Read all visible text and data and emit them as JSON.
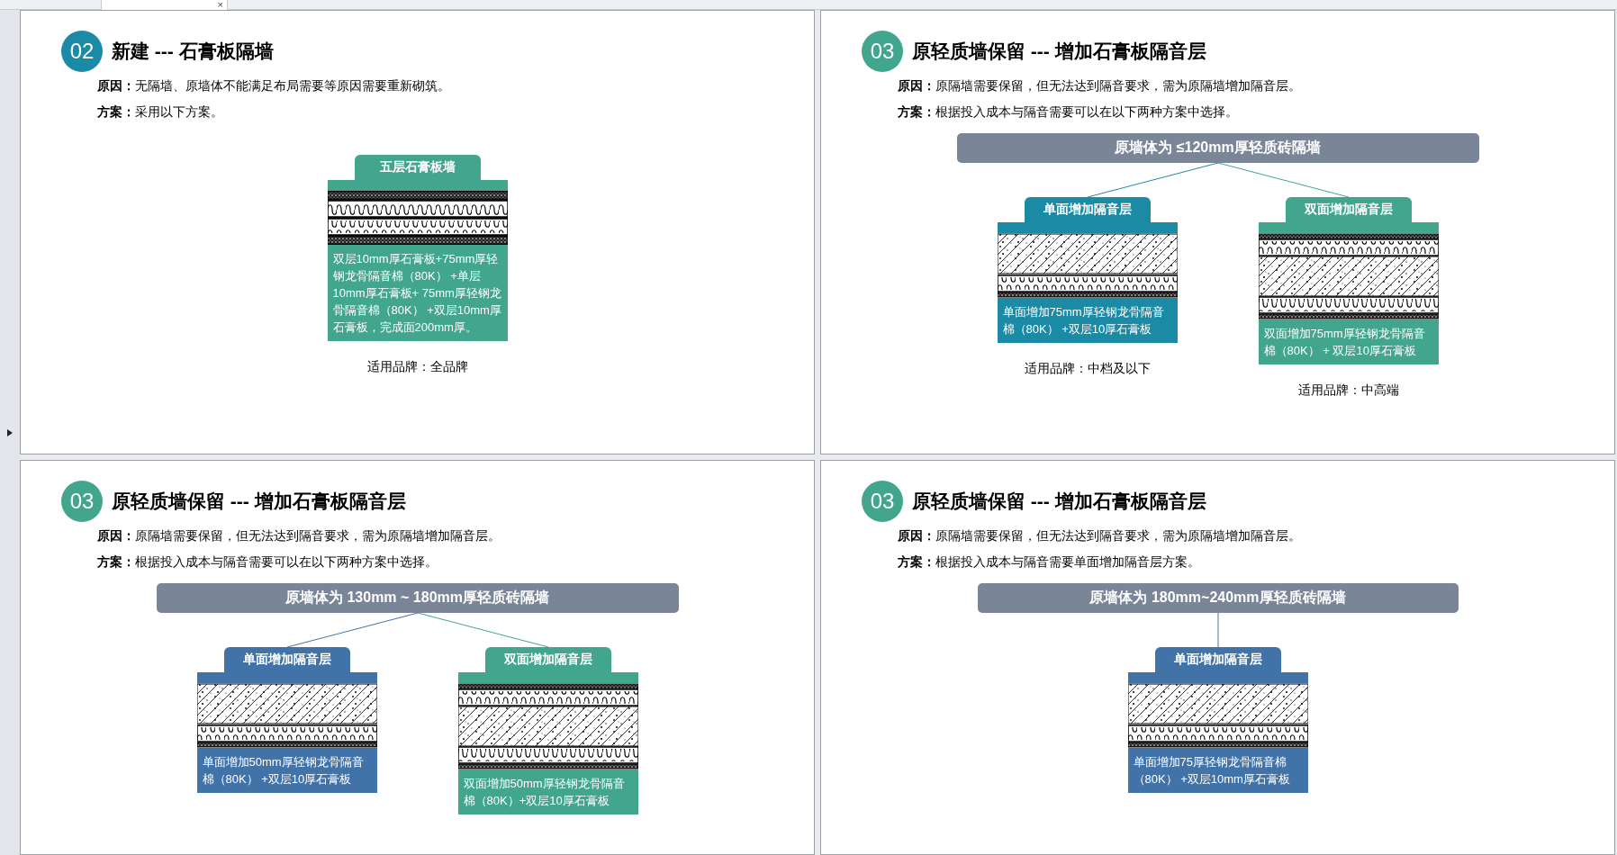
{
  "tab": {
    "close": "×"
  },
  "pages": [
    {
      "number": "02",
      "color": "#1a8aa6",
      "title": "新建 --- 石膏板隔墙",
      "reason": "**原因：**无隔墙、原墙体不能满足布局需要等原因需要重新砌筑。",
      "plan": "**方案：**采用以下方案。",
      "options": [
        {
          "label": "五层石膏板墙",
          "color": "#42a58e",
          "kind": "stud-wall",
          "description": "双层10mm厚石膏板+75mm厚轻钢龙骨隔音棉（80K） +单层10mm厚石膏板+ 75mm厚轻钢龙骨隔音棉（80K） +双层10mm厚石膏板，完成面200mm厚。",
          "brand": "适用品牌：全品牌"
        }
      ]
    },
    {
      "number": "03",
      "color": "#42a58e",
      "title": "原轻质墙保留 --- 增加石膏板隔音层",
      "reason": "**原因：**原隔墙需要保留，但无法达到隔音要求，需为原隔墙增加隔音层。",
      "plan": "**方案：**根据投入成本与隔音需要可以在以下两种方案中选择。",
      "wall_type": "原墙体为 ≤120mm厚轻质砖隔墙",
      "options": [
        {
          "label": "单面增加隔音层",
          "color": "#1b8aa5",
          "kind": "single",
          "description": "单面增加75mm厚轻钢龙骨隔音棉（80K） +双层10厚石膏板",
          "brand": "适用品牌：中档及以下"
        },
        {
          "label": "双面增加隔音层",
          "color": "#42a58e",
          "kind": "double",
          "description": "双面增加75mm厚轻钢龙骨隔音棉（80K） + 双层10厚石膏板",
          "brand": "适用品牌：中高端"
        }
      ]
    },
    {
      "number": "03",
      "color": "#42a58e",
      "title": "原轻质墙保留 --- 增加石膏板隔音层",
      "reason": "**原因：**原隔墙需要保留，但无法达到隔音要求，需为原隔墙增加隔音层。",
      "plan": "**方案：**根据投入成本与隔音需要可以在以下两种方案中选择。",
      "wall_type": "原墙体为 130mm ~ 180mm厚轻质砖隔墙",
      "options": [
        {
          "label": "单面增加隔音层",
          "color": "#4273a8",
          "kind": "single",
          "description": "单面增加50mm厚轻钢龙骨隔音棉（80K） +双层10厚石膏板"
        },
        {
          "label": "双面增加隔音层",
          "color": "#42a58e",
          "kind": "double",
          "description": "双面增加50mm厚轻钢龙骨隔音棉（80K）+双层10厚石膏板"
        }
      ]
    },
    {
      "number": "03",
      "color": "#42a58e",
      "title": "原轻质墙保留 --- 增加石膏板隔音层",
      "reason": "**原因：**原隔墙需要保留，但无法达到隔音要求，需为原隔墙增加隔音层。",
      "plan": "**方案：**根据投入成本与隔音需要单面增加隔音层方案。",
      "wall_type": "原墙体为  180mm~240mm厚轻质砖隔墙",
      "options": [
        {
          "label": "单面增加隔音层",
          "color": "#4273a8",
          "kind": "single",
          "description": "单面增加75厚轻钢龙骨隔音棉（80K） +双层10mm厚石膏板"
        }
      ]
    }
  ]
}
